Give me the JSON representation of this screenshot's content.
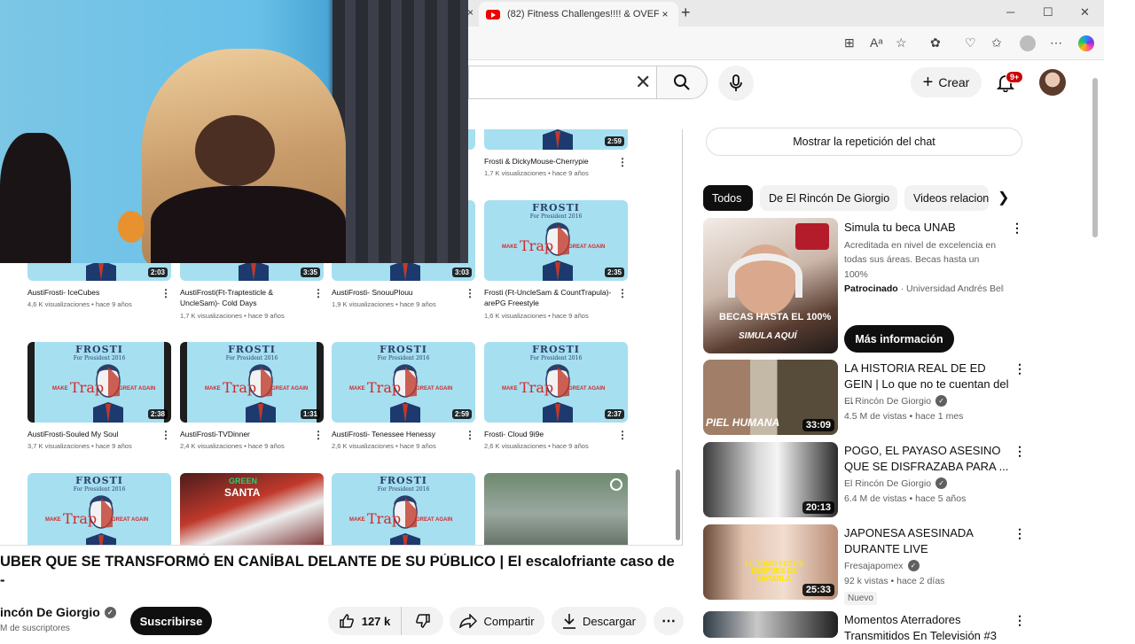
{
  "browser": {
    "tab_title": "(82) Fitness Challenges!!!! & OVEF",
    "tab_close": "×",
    "prev_tab_close": "×",
    "new_tab": "+",
    "window_controls": [
      "─",
      "☐",
      "✕"
    ]
  },
  "header": {
    "create_label": "Crear",
    "notification_count": "9+"
  },
  "grid": {
    "rows": [
      [
        {
          "title": "",
          "meta": "",
          "duration": "",
          "style": "poster"
        },
        {
          "title": "",
          "meta": "",
          "duration": "",
          "style": "poster"
        },
        {
          "title": "",
          "meta": "",
          "duration": "",
          "style": "poster"
        },
        {
          "title": "Frosti & DickyMouse-Cherrypie",
          "meta": "1,7 K visualizaciones • hace 9 años",
          "duration": "2:59",
          "style": "poster"
        }
      ],
      [
        {
          "title": "AustiFrosti- IceCubes",
          "meta": "4,6 K visualizaciones • hace 9 años",
          "duration": "2:03",
          "style": "poster"
        },
        {
          "title": "AustiFrosti(Ft-Traptesticle & UncleSam)- Cold Days",
          "meta": "1,7 K visualizaciones • hace 9 años",
          "duration": "3:35",
          "style": "poster"
        },
        {
          "title": "AustiFrosti- SnouuPlouu",
          "meta": "1,9 K visualizaciones • hace 9 años",
          "duration": "3:03",
          "style": "poster"
        },
        {
          "title": "Frosti (Ft-UncleSam & CountTrapula)- arePG Freestyle",
          "meta": "1,6 K visualizaciones • hace 9 años",
          "duration": "2:35",
          "style": "poster"
        }
      ],
      [
        {
          "title": "AustiFrosti-Souled My Soul",
          "meta": "3,7 K visualizaciones • hace 9 años",
          "duration": "2:38",
          "style": "dark"
        },
        {
          "title": "AustiFrosti-TVDinner",
          "meta": "2,4 K visualizaciones • hace 9 años",
          "duration": "1:31",
          "style": "dark"
        },
        {
          "title": "AustiFrosti- Tenessee Henessy",
          "meta": "2,6 K visualizaciones • hace 9 años",
          "duration": "2:59",
          "style": "poster"
        },
        {
          "title": "Frosti- Cloud 9i9e",
          "meta": "2,6 K visualizaciones • hace 9 años",
          "duration": "2:37",
          "style": "poster"
        }
      ],
      [
        {
          "title": "",
          "meta": "",
          "duration": "",
          "style": "poster"
        },
        {
          "title": "",
          "meta": "",
          "duration": "",
          "style": "christmas"
        },
        {
          "title": "",
          "meta": "",
          "duration": "",
          "style": "poster"
        },
        {
          "title": "",
          "meta": "",
          "duration": "",
          "style": "vlog"
        }
      ]
    ],
    "poster": {
      "title": "FROSTI",
      "sub": "For President 2016",
      "trap": "Trap",
      "great_again": "GREAT AGAIN",
      "make": "MAKE"
    },
    "christmas": {
      "green": "GREEN",
      "santa": "SANTA"
    }
  },
  "video": {
    "title_line1": "UBER QUE SE TRANSFORMÓ EN CANÍBAL DELANTE DE SU PÚBLICO | El escalofriante caso de",
    "title_line2": "-",
    "channel": "incón De Giorgio",
    "subscribers": "M de suscriptores",
    "subscribe_label": "Suscribirse",
    "likes": "127 k",
    "share_label": "Compartir",
    "download_label": "Descargar"
  },
  "sidebar": {
    "chat_replay": "Mostrar la repetición del chat",
    "chips": [
      "Todos",
      "De El Rincón De Giorgio",
      "Videos relacionados"
    ],
    "ad": {
      "title": "Simula tu beca UNAB",
      "description": "Acreditada en nivel de excelencia en todas sus áreas. Becas hasta un 100%",
      "sponsored": "Patrocinado",
      "advertiser": "Universidad Andrés Bello",
      "cta": "Más información",
      "image_text_1": "BECAS HASTA EL 100%",
      "image_text_2": "SIMULA AQUÍ"
    },
    "recommendations": [
      {
        "title": "LA HISTORIA REAL DE ED GEIN | Lo que no te cuentan del ...",
        "channel": "El Rincón De Giorgio",
        "meta": "4.5 M de vistas • hace 1 mes",
        "duration": "33:09",
        "thumb_label": "PIEL HUMANA",
        "badge": ""
      },
      {
        "title": "POGO, EL PAYASO ASESINO QUE SE DISFRAZABA PARA ...",
        "channel": "El Rincón De Giorgio",
        "meta": "6.4 M de vistas • hace 5 años",
        "duration": "20:13",
        "thumb_label": "",
        "badge": ""
      },
      {
        "title": "JAPONESA ASESINADA DURANTE LIVE",
        "channel": "Fresajapomex",
        "meta": "92 k vistas • hace 2 días",
        "duration": "25:33",
        "thumb_label": "LE TOMO FOTOS DESPUES DE MATARLA",
        "badge": "Nuevo"
      },
      {
        "title": "Momentos Aterradores Transmitidos En Televisión #3",
        "channel": "",
        "meta": "",
        "duration": "",
        "thumb_label": "",
        "badge": ""
      }
    ]
  }
}
